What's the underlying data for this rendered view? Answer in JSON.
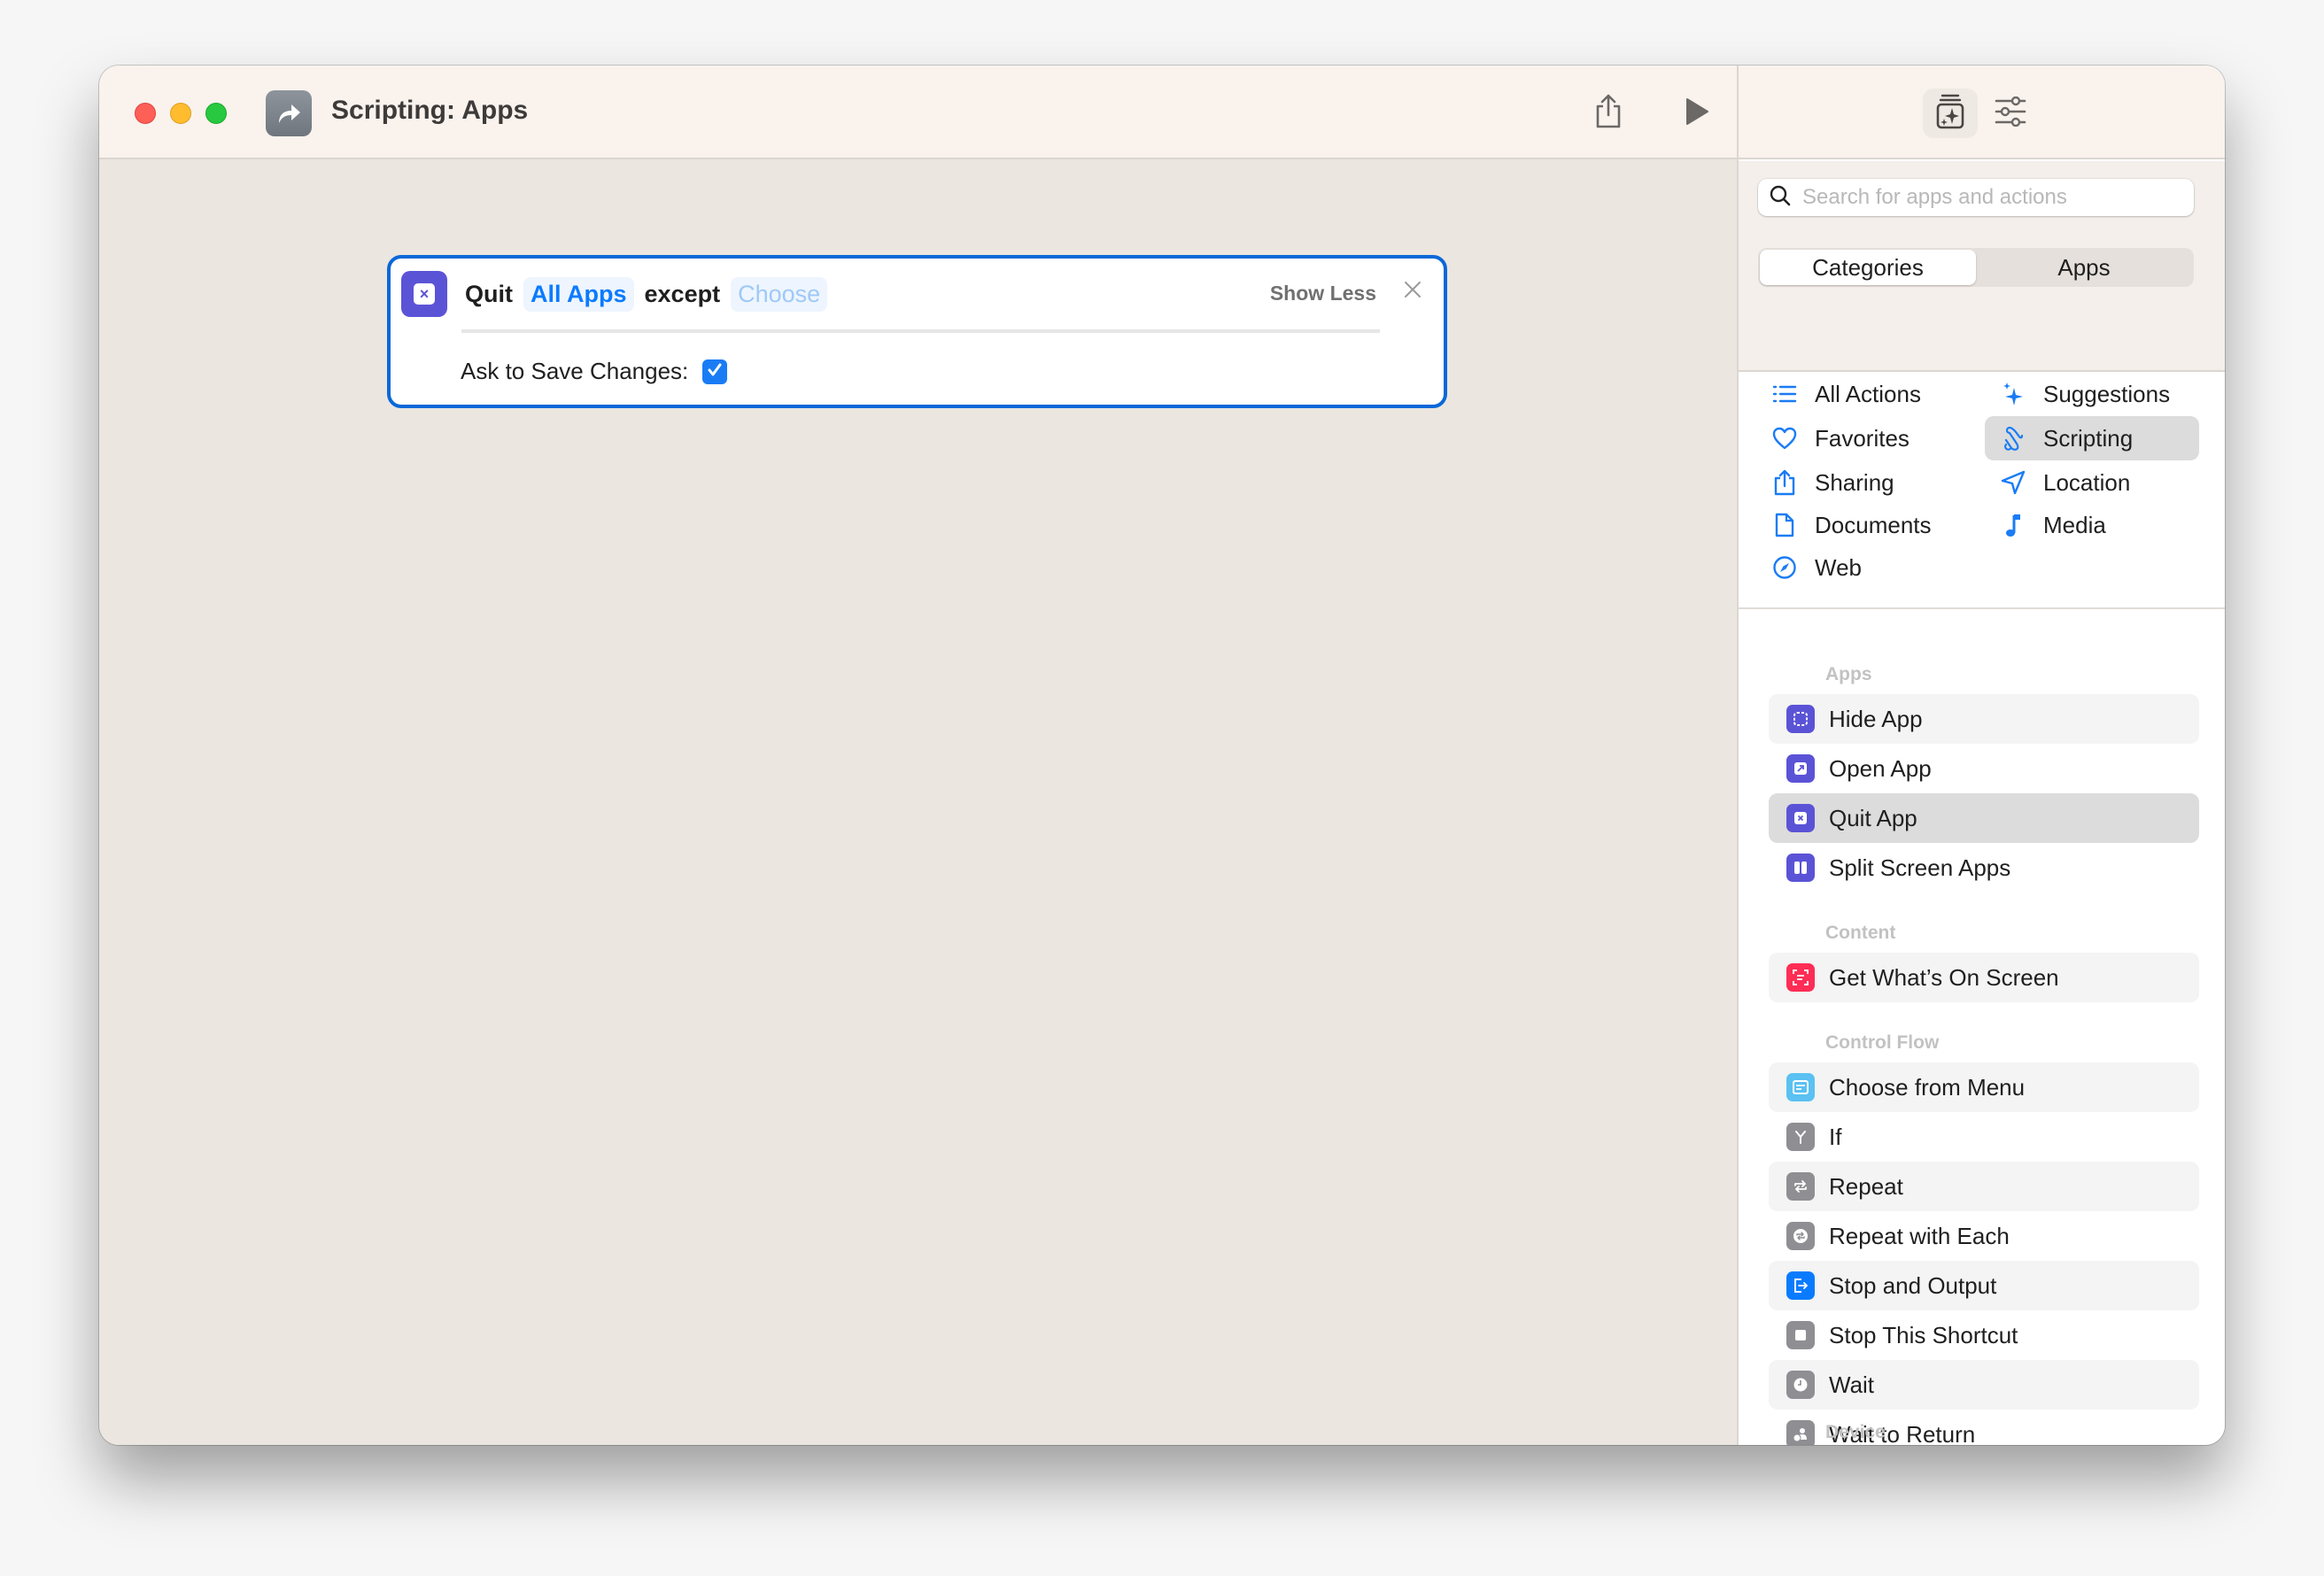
{
  "window": {
    "title": "Scripting: Apps",
    "app_icon": "shortcut-arrow-icon"
  },
  "toolbar": {
    "share_icon": "share-icon",
    "run_icon": "play-icon",
    "library_icon": "action-library-icon",
    "settings_icon": "sliders-icon"
  },
  "action_card": {
    "verb": "Quit",
    "target": "All Apps",
    "connector": "except",
    "exception_placeholder": "Choose",
    "show_less_label": "Show Less",
    "param_label": "Ask to Save Changes:",
    "ask_to_save_checked": true,
    "icon_color": "#5b53d6"
  },
  "sidebar": {
    "search_placeholder": "Search for apps and actions",
    "search_value": "",
    "segments": [
      "Categories",
      "Apps"
    ],
    "active_segment": "Categories",
    "categories_left": [
      {
        "label": "All Actions",
        "icon": "list-icon"
      },
      {
        "label": "Favorites",
        "icon": "heart-icon"
      },
      {
        "label": "Sharing",
        "icon": "share-icon"
      },
      {
        "label": "Documents",
        "icon": "document-icon"
      },
      {
        "label": "Web",
        "icon": "compass-icon"
      }
    ],
    "categories_right": [
      {
        "label": "Suggestions",
        "icon": "sparkles-icon"
      },
      {
        "label": "Scripting",
        "icon": "scroll-icon",
        "selected": true
      },
      {
        "label": "Location",
        "icon": "location-arrow-icon"
      },
      {
        "label": "Media",
        "icon": "music-note-icon"
      }
    ],
    "sections": [
      {
        "title": "Apps",
        "actions": [
          {
            "label": "Hide App",
            "icon": "hide-app-icon",
            "color": "#5b53d6"
          },
          {
            "label": "Open App",
            "icon": "open-app-icon",
            "color": "#5b53d6"
          },
          {
            "label": "Quit App",
            "icon": "quit-app-icon",
            "color": "#5b53d6",
            "selected": true
          },
          {
            "label": "Split Screen Apps",
            "icon": "split-screen-icon",
            "color": "#5b53d6"
          }
        ]
      },
      {
        "title": "Content",
        "actions": [
          {
            "label": "Get What’s On Screen",
            "icon": "screen-scan-icon",
            "color": "#fe2d55"
          }
        ]
      },
      {
        "title": "Control Flow",
        "actions": [
          {
            "label": "Choose from Menu",
            "icon": "menu-icon",
            "color": "#5ac1f2"
          },
          {
            "label": "If",
            "icon": "branch-icon",
            "color": "#8e8e93"
          },
          {
            "label": "Repeat",
            "icon": "repeat-icon",
            "color": "#8e8e93"
          },
          {
            "label": "Repeat with Each",
            "icon": "repeat-each-icon",
            "color": "#8e8e93"
          },
          {
            "label": "Stop and Output",
            "icon": "stop-output-icon",
            "color": "#0a7bff"
          },
          {
            "label": "Stop This Shortcut",
            "icon": "stop-icon",
            "color": "#8e8e93"
          },
          {
            "label": "Wait",
            "icon": "clock-icon",
            "color": "#8e8e93"
          },
          {
            "label": "Wait to Return",
            "icon": "wait-return-icon",
            "color": "#8e8e93"
          }
        ]
      },
      {
        "title": "Device",
        "actions": []
      }
    ]
  }
}
